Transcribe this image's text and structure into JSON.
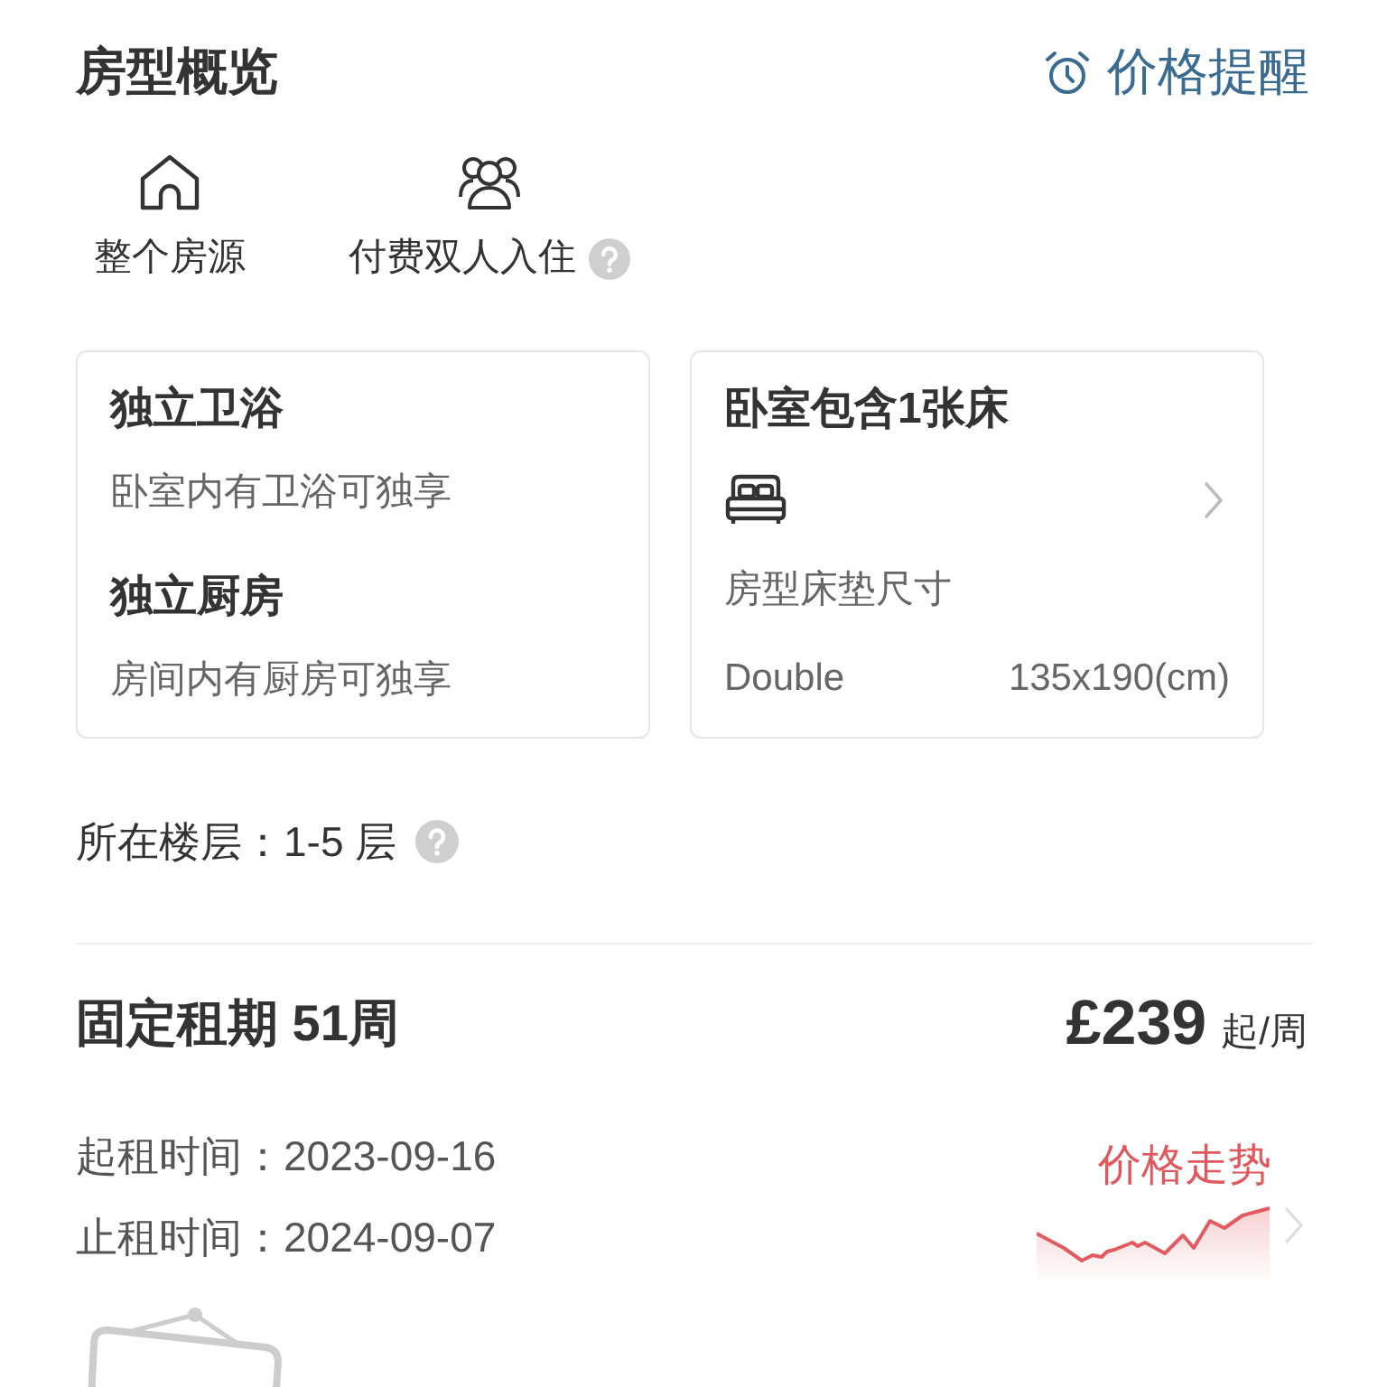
{
  "header": {
    "title": "房型概览",
    "price_alert": "价格提醒"
  },
  "features": [
    {
      "kind": "house",
      "label": "整个房源",
      "help": false
    },
    {
      "kind": "people",
      "label": "付费双人入住",
      "help": true
    }
  ],
  "cards": [
    {
      "kind": "amenities",
      "items": [
        {
          "title": "独立卫浴",
          "description": "卧室内有卫浴可独享"
        },
        {
          "title": "独立厨房",
          "description": "房间内有厨房可独享"
        }
      ]
    },
    {
      "kind": "bed",
      "title": "卧室包含1张床",
      "caption": "房型床垫尺寸",
      "bed_type": "Double",
      "size": "135x190(cm)"
    }
  ],
  "floor": {
    "text": "所在楼层：1-5 层",
    "help": true
  },
  "lease": {
    "title": "固定租期 51周",
    "price": "£239",
    "price_unit": "起/周",
    "start": "起租时间：2023-09-16",
    "end": "止租时间：2024-09-07",
    "trend_label": "价格走势",
    "booked_sign": true
  }
}
